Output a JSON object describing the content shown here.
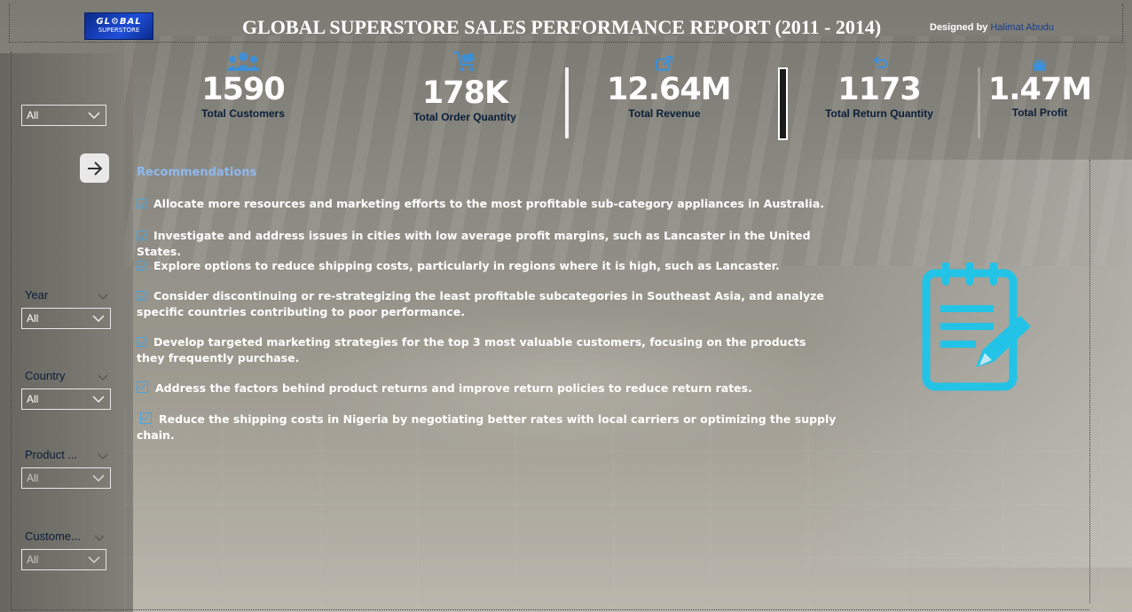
{
  "header": {
    "logo_line1": "GL⚙BAL",
    "logo_line2": "SUPERSTORE",
    "title": "GLOBAL SUPERSTORE SALES PERFORMANCE REPORT (2011 - 2014)",
    "designed_by": "Designed by",
    "designer_name": "Halimat Abudu"
  },
  "kpis": [
    {
      "value": "1590",
      "label": "Total Customers",
      "icon": "users-icon"
    },
    {
      "value": "178K",
      "label": "Total Order Quantity",
      "icon": "cart-icon"
    },
    {
      "value": "12.64M",
      "label": "Total Revenue",
      "icon": "revenue-icon"
    },
    {
      "value": "1173",
      "label": "Total Return Quantity",
      "icon": "return-icon"
    },
    {
      "value": "1.47M",
      "label": "Total Profit",
      "icon": "profit-icon"
    }
  ],
  "slicers": {
    "top": {
      "value": "All"
    },
    "year": {
      "label": "Year",
      "value": "All"
    },
    "country": {
      "label": "Country",
      "value": "All"
    },
    "product": {
      "label": "Product ...",
      "value": "All"
    },
    "customer": {
      "label": "Custome...",
      "value": "All"
    }
  },
  "recommendations": {
    "title": "Recommendations",
    "items": [
      "Allocate more resources and marketing efforts to the most profitable sub-category appliances in Australia.",
      "Investigate and address issues in cities with low average profit margins, such as Lancaster in the United States.",
      "Explore options to reduce shipping costs, particularly in regions where it is high, such as Lancaster.",
      "Consider discontinuing or re-strategizing the least profitable subcategories in Southeast Asia, and analyze specific countries contributing to  poor performance.",
      "Develop targeted marketing strategies for the top 3 most valuable customers, focusing on the products they frequently purchase.",
      "Address the factors behind product returns and improve return policies to reduce return rates.",
      "Reduce the shipping costs in Nigeria by negotiating better rates with local carriers or optimizing the supply chain."
    ]
  },
  "colors": {
    "accent_blue": "#4aa3e0",
    "title_light_blue": "#8fb8ef",
    "notepad_cyan": "#22c3e6"
  }
}
